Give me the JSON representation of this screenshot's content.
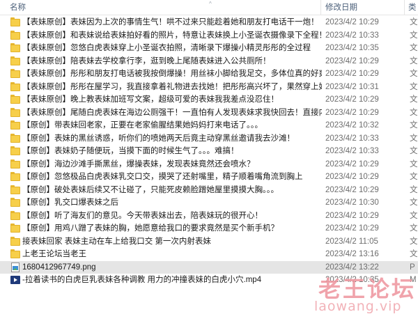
{
  "header": {
    "name_label": "名称",
    "date_label": "修改日期",
    "type_label": "类"
  },
  "files": [
    {
      "kind": "folder",
      "name": "【表妹原创】表妹因为上次的事情生气！哄不过来只能趁着她和朋友打电话干一炮！",
      "date": "2023/4/2 10:29",
      "type": "文"
    },
    {
      "kind": "folder",
      "name": "【表妹原创】和表妹说给表妹拍好看的照片，特意让表妹换上小圣诞衣摄像录下全程！",
      "date": "2023/4/2 10:33",
      "type": "文"
    },
    {
      "kind": "folder",
      "name": "【表妹原创】忽悠白虎表妹穿上小圣诞衣拍照，清晰录下爆操小精灵彤彤的全过程",
      "date": "2023/4/2 10:35",
      "type": "文"
    },
    {
      "kind": "folder",
      "name": "【表妹原创】陪表妹去学校拿行李，逛到晚上尾随表妹进入公共厕所！",
      "date": "2023/4/2 10:29",
      "type": "文"
    },
    {
      "kind": "folder",
      "name": "【表妹原创】彤彤和朋友打电话被我按倒爆操！用丝袜小脚给我足交，多体位真的好爽！",
      "date": "2023/4/2 10:29",
      "type": "文"
    },
    {
      "kind": "folder",
      "name": "【表妹原创】彤彤在屋学习，我直接拿着礼物进去找她！把彤彤高兴坏了，果然穿上好美",
      "date": "2023/4/2 10:31",
      "type": "文"
    },
    {
      "kind": "folder",
      "name": "【表妹原创】晚上教表妹加班写文案，超级可爱的表妹我我差点没忍住！",
      "date": "2023/4/2 10:29",
      "type": "文"
    },
    {
      "kind": "folder",
      "name": "【表妹原创】尾随白虎表妹在海边公厕强干！一直怕有人发现表妹求我快回去！直接内射",
      "date": "2023/4/2 10:29",
      "type": "文"
    },
    {
      "kind": "folder",
      "name": "【原创】带表妹回老家，正要在老家偷腥结果她妈妈打来电话了。。。",
      "date": "2023/4/2 10:32",
      "type": "文"
    },
    {
      "kind": "folder",
      "name": "【原创】表妹的黑丝诱惑，听你们的喷她两天后竟主动穿黑丝邀请我去沙滩！",
      "date": "2023/4/2 10:33",
      "type": "文"
    },
    {
      "kind": "folder",
      "name": "【原创】表妹奶子随便玩，当摸下面的时候生气了。。。难搞！",
      "date": "2023/4/2 10:33",
      "type": "文"
    },
    {
      "kind": "folder",
      "name": "【原创】海边沙滩手撕黑丝，爆操表妹，发现表妹竟然还会喷水？",
      "date": "2023/4/2 10:29",
      "type": "文"
    },
    {
      "kind": "folder",
      "name": "【原创】忽悠极品白虎表妹乳交口交，摸哭了还射嘴里，精子顺着嘴角流到胸上",
      "date": "2023/4/2 10:29",
      "type": "文"
    },
    {
      "kind": "folder",
      "name": "【原创】破处表妹后续又不让碰了，只能死皮赖脸蹭她屋里摸摸大胸。。。",
      "date": "2023/4/2 10:29",
      "type": "文"
    },
    {
      "kind": "folder",
      "name": "【原创】乳交口爆表妹之后",
      "date": "2023/4/2 10:30",
      "type": "文"
    },
    {
      "kind": "folder",
      "name": "【原创】听了海友们的意见。今天带表妹出去，陪表妹玩的很开心！",
      "date": "2023/4/2 10:29",
      "type": "文"
    },
    {
      "kind": "folder",
      "name": "【原创】用鸡八蹭了表妹的胸，她愿意给我口的要求竟然是买个新手机？",
      "date": "2023/4/2 10:29",
      "type": "文"
    },
    {
      "kind": "folder",
      "name": "接表妹回家 表妹主动在车上给我口交 第一次内射表妹",
      "date": "2023/4/2 11:05",
      "type": "文"
    },
    {
      "kind": "folder",
      "name": "上老王论坛当老王",
      "date": "2023/4/2 13:16",
      "type": "文"
    },
    {
      "kind": "png",
      "name": "1680412967749.png",
      "date": "2023/4/2 13:22",
      "type": "P"
    },
    {
      "kind": "mp4",
      "name": "-拉着读书的白虎巨乳表妹各种调教 用力的冲撞表妹的白虎小穴.mp4",
      "date": "2023/4/2 10:35",
      "type": "M"
    }
  ],
  "selected_index": 19,
  "watermark": {
    "site_name": "老王论坛",
    "url": "laowang.vip"
  },
  "colors": {
    "folder": "#f7cf4a",
    "selection": "#e5e5e5",
    "header_text": "#4c607a",
    "watermark": "#ef9aa2"
  }
}
